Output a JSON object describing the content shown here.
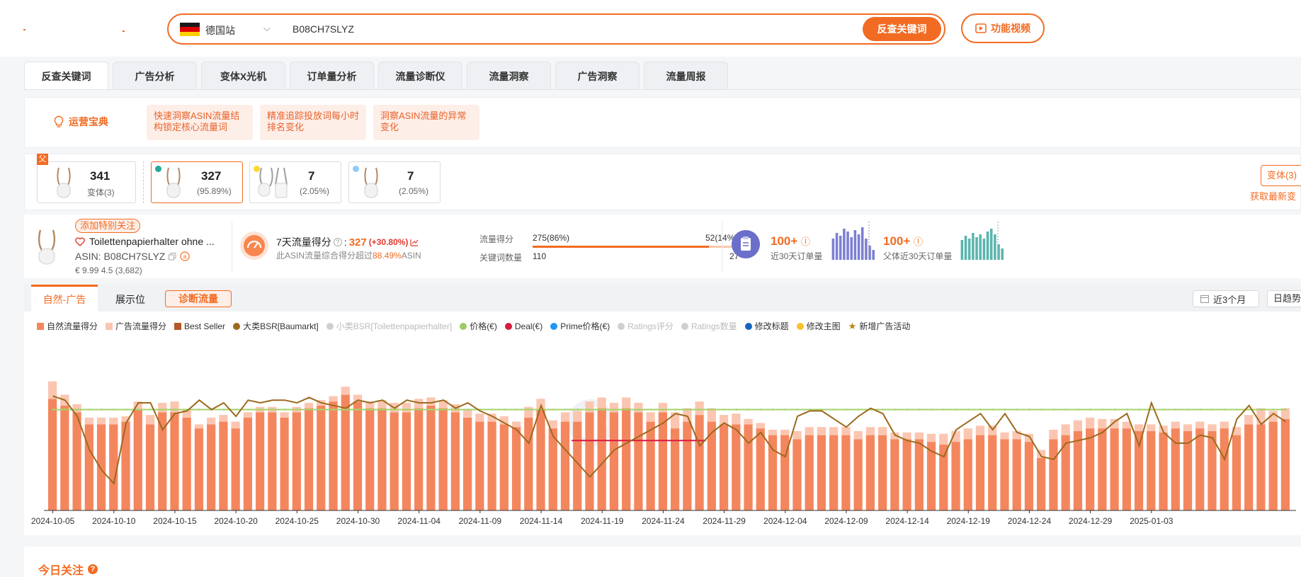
{
  "search": {
    "site": "德国站",
    "query": "B08CH7SLYZ",
    "button": "反查关键词",
    "video_button": "功能视频",
    "flag_colors": [
      "#1a1a1a",
      "#dd0000",
      "#ffce00"
    ]
  },
  "tabs": [
    "反查关键词",
    "广告分析",
    "变体X光机",
    "订单量分析",
    "流量诊断仪",
    "流量洞察",
    "广告洞察",
    "流量周报"
  ],
  "tips": {
    "title": "运营宝典",
    "cards": [
      "快速洞察ASIN流量结构锁定核心流量词",
      "精准追踪投放词每小时排名变化",
      "洞察ASIN流量的异常变化"
    ]
  },
  "variants": {
    "parent_tag": "父",
    "cards": [
      {
        "num": "341",
        "sub": "变体(3)",
        "dot": ""
      },
      {
        "num": "327",
        "sub": "(95.89%)",
        "dot": "#26a69a"
      },
      {
        "num": "7",
        "sub": "(2.05%)",
        "dot": "#fdd835"
      },
      {
        "num": "7",
        "sub": "(2.05%)",
        "dot": "#90caf9"
      }
    ],
    "variant_button": "变体(3)",
    "refresh_link": "获取最新变"
  },
  "product": {
    "attention_button": "添加特别关注",
    "title": "Toilettenpapierhalter ohne ...",
    "asin": "ASIN:  B08CH7SLYZ",
    "price": "€ 9.99  4.5 (3,682)",
    "score_label": "7天流量得分",
    "score_value": "327",
    "score_delta": "(+30.80%)",
    "score_sub_prefix": "此ASIN流量综合得分超过",
    "score_sub_pct": "88.49%",
    "score_sub_suffix": "ASIN",
    "flow_label": "流量得分",
    "flow_natural": "275(86%)",
    "flow_ad": "52(14%)",
    "flow_ratio": 0.86,
    "kw_label": "关键词数量",
    "kw_natural": "110",
    "kw_ad": "27",
    "orders_value": "100+",
    "orders_label": "近30天订单量",
    "parent_orders_value": "100+",
    "parent_orders_label": "父体近30天订单量",
    "orders_bars": [
      30,
      38,
      34,
      44,
      40,
      32,
      42,
      36,
      46,
      30,
      20,
      14
    ],
    "parent_orders_bars": [
      28,
      34,
      30,
      38,
      32,
      36,
      30,
      40,
      44,
      36,
      22,
      16
    ]
  },
  "chart_header": {
    "tab_natural_ad": "自然-广告",
    "tab_position": "展示位",
    "diagnose_button": "诊断流量",
    "range_button": "近3个月",
    "trend_button": "日趋势"
  },
  "legend": [
    {
      "label": "自然流量得分",
      "color": "#f4865e",
      "shape": "sw",
      "on": true
    },
    {
      "label": "广告流量得分",
      "color": "#fbc6b1",
      "shape": "sw",
      "on": true
    },
    {
      "label": "Best Seller",
      "color": "#b5582a",
      "shape": "sw",
      "on": true
    },
    {
      "label": "大类BSR[Baumarkt]",
      "color": "#9c6a1c",
      "shape": "dot",
      "on": true
    },
    {
      "label": "小类BSR[Toilettenpapierhalter]",
      "color": "#cfcfcf",
      "shape": "dot",
      "on": false
    },
    {
      "label": "价格(€)",
      "color": "#9ccc65",
      "shape": "dot",
      "on": true
    },
    {
      "label": "Deal(€)",
      "color": "#d81b40",
      "shape": "dot",
      "on": true
    },
    {
      "label": "Prime价格(€)",
      "color": "#2196f3",
      "shape": "dot",
      "on": true
    },
    {
      "label": "Ratings评分",
      "color": "#cfcfcf",
      "shape": "dot",
      "on": false
    },
    {
      "label": "Ratings数量",
      "color": "#cfcfcf",
      "shape": "dot",
      "on": false
    },
    {
      "label": "修改标题",
      "color": "#1565c0",
      "shape": "dot",
      "on": true
    },
    {
      "label": "修改主图",
      "color": "#fbc02d",
      "shape": "dot",
      "on": true
    },
    {
      "label": "新增广告活动",
      "color": "#b8860b",
      "shape": "star",
      "on": true
    }
  ],
  "chart_data": {
    "type": "bar",
    "x_tick_labels": [
      "2024-10-05",
      "2024-10-10",
      "2024-10-15",
      "2024-10-20",
      "2024-10-25",
      "2024-10-30",
      "2024-11-04",
      "2024-11-09",
      "2024-11-14",
      "2024-11-19",
      "2024-11-24",
      "2024-11-29",
      "2024-12-04",
      "2024-12-09",
      "2024-12-14",
      "2024-12-19",
      "2024-12-24",
      "2024-12-29",
      "2025-01-03"
    ],
    "start_date": "2024-10-05",
    "ylim": [
      0,
      100
    ],
    "series": [
      {
        "name": "自然流量得分",
        "values": [
          83,
          78,
          73,
          64,
          64,
          64,
          66,
          75,
          64,
          73,
          73,
          69,
          61,
          64,
          66,
          61,
          69,
          73,
          73,
          69,
          73,
          76,
          78,
          81,
          86,
          81,
          76,
          76,
          73,
          73,
          76,
          78,
          76,
          73,
          69,
          66,
          66,
          64,
          62,
          69,
          75,
          61,
          66,
          66,
          73,
          76,
          73,
          76,
          73,
          66,
          73,
          61,
          66,
          71,
          66,
          64,
          64,
          64,
          61,
          56,
          56,
          53,
          56,
          56,
          56,
          56,
          53,
          56,
          56,
          53,
          53,
          53,
          51,
          49,
          51,
          53,
          56,
          56,
          53,
          53,
          51,
          39,
          53,
          56,
          59,
          61,
          61,
          61,
          61,
          59,
          59,
          58,
          61,
          59,
          61,
          59,
          61,
          56,
          64,
          64,
          66,
          68
        ],
        "ad_values": [
          13,
          8,
          6,
          5,
          5,
          5,
          4,
          6,
          7,
          7,
          8,
          6,
          3,
          5,
          5,
          5,
          4,
          4,
          4,
          4,
          4,
          4,
          4,
          4,
          6,
          5,
          5,
          6,
          7,
          7,
          7,
          6,
          6,
          6,
          6,
          6,
          6,
          6,
          4,
          8,
          8,
          6,
          7,
          8,
          8,
          8,
          7,
          8,
          7,
          7,
          7,
          12,
          10,
          10,
          10,
          7,
          8,
          4,
          4,
          4,
          4,
          6,
          6,
          6,
          6,
          6,
          6,
          6,
          6,
          5,
          5,
          5,
          6,
          8,
          8,
          8,
          7,
          7,
          5,
          6,
          6,
          6,
          7,
          8,
          8,
          8,
          7,
          7,
          5,
          5,
          5,
          5,
          5,
          5,
          5,
          5,
          5,
          6,
          7,
          12,
          8,
          8
        ]
      },
      {
        "name": "大类BSR[Baumarkt]",
        "values": [
          85,
          82,
          70,
          45,
          30,
          20,
          65,
          80,
          80,
          60,
          72,
          74,
          82,
          75,
          80,
          70,
          82,
          80,
          82,
          82,
          80,
          84,
          80,
          78,
          76,
          82,
          80,
          82,
          76,
          82,
          80,
          80,
          82,
          76,
          80,
          74,
          70,
          65,
          60,
          50,
          78,
          55,
          45,
          35,
          25,
          35,
          45,
          50,
          55,
          60,
          65,
          72,
          70,
          48,
          58,
          65,
          60,
          50,
          58,
          45,
          40,
          70,
          74,
          74,
          68,
          62,
          70,
          76,
          72,
          56,
          52,
          50,
          44,
          40,
          60,
          66,
          72,
          60,
          72,
          58,
          55,
          40,
          38,
          50,
          52,
          54,
          58,
          66,
          72,
          48,
          80,
          58,
          50,
          50,
          56,
          54,
          38,
          68,
          78,
          64,
          72,
          66
        ]
      },
      {
        "name": "价格(€)",
        "values": [
          75,
          75,
          75,
          75,
          75,
          75,
          75,
          75,
          75,
          75,
          75,
          75,
          75,
          75,
          75,
          75,
          75,
          75,
          75,
          75,
          75,
          75,
          75,
          75,
          75,
          75,
          75,
          75,
          75,
          75,
          75,
          75,
          75,
          75,
          75,
          75,
          75,
          75,
          75,
          75,
          75,
          75,
          75,
          75,
          75,
          75,
          75,
          75,
          75,
          75,
          75,
          75,
          75,
          75,
          75,
          75,
          75,
          75,
          75,
          75,
          75,
          75,
          75,
          75,
          75,
          75,
          75,
          75,
          75,
          75,
          75,
          75,
          75,
          75,
          75,
          75,
          75,
          75,
          75,
          75,
          75,
          75,
          75,
          75,
          75,
          75,
          75,
          75,
          75,
          75,
          75,
          75,
          75,
          75,
          75,
          75,
          75,
          75,
          75,
          75,
          75,
          75
        ]
      },
      {
        "name": "Deal(€)",
        "values": []
      }
    ]
  },
  "today": {
    "title": "今日关注",
    "help": "?"
  }
}
